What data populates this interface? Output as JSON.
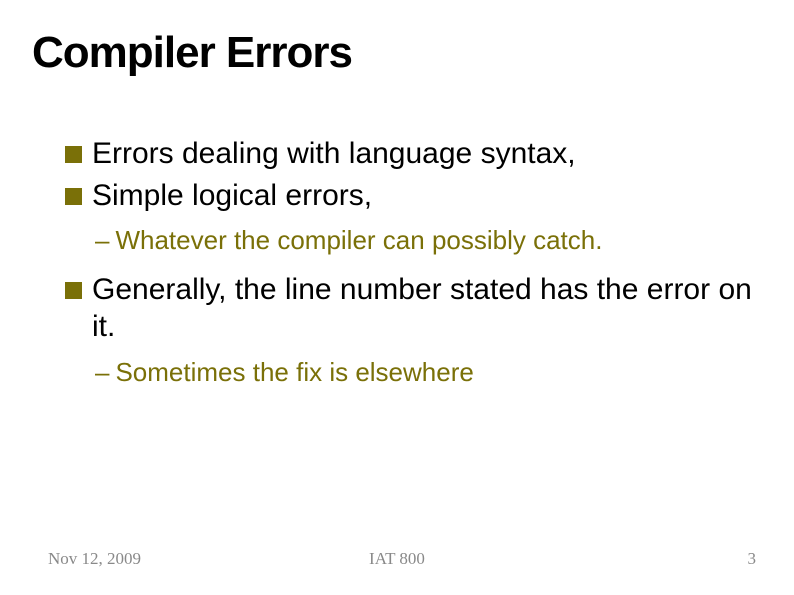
{
  "title": "Compiler Errors",
  "bullets": [
    {
      "level": 1,
      "text": "Errors dealing with language syntax,"
    },
    {
      "level": 1,
      "text": "Simple logical errors,"
    },
    {
      "level": 2,
      "text": "Whatever the compiler can possibly catch."
    },
    {
      "level": 1,
      "text": "Generally, the line number stated has the error on it."
    },
    {
      "level": 2,
      "text": "Sometimes the fix is elsewhere"
    }
  ],
  "footer": {
    "date": "Nov 12, 2009",
    "center": "IAT 800",
    "page": "3"
  },
  "colors": {
    "accent": "#7a7008",
    "footer_text": "#898989"
  }
}
